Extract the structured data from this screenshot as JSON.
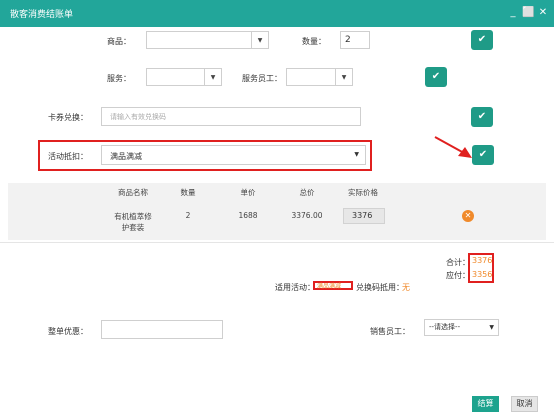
{
  "window": {
    "title": "散客消费结账单",
    "min": "_",
    "restore": "⬜",
    "close": "✕"
  },
  "form": {
    "product_label": "商品：",
    "product_value": "",
    "qty_label": "数量：",
    "qty_value": "2",
    "service_label": "服务：",
    "service_value": "",
    "staff_label": "服务员工：",
    "staff_value": "",
    "card_label": "卡券兑换：",
    "card_placeholder": "请输入有效兑换码",
    "promo_label": "活动抵扣：",
    "promo_value": "满品满减"
  },
  "table": {
    "headers": [
      "商品名称",
      "数量",
      "单价",
      "总价",
      "实际价格"
    ],
    "rows": [
      {
        "name": "有机植萃修护套装",
        "name_line1": "有机植萃修",
        "name_line2": "护套装",
        "qty": "2",
        "price": "1688",
        "total": "3376.00",
        "actual": "3376"
      }
    ]
  },
  "summary": {
    "total_label": "合计：",
    "total_value": "3376",
    "due_label": "应付：",
    "due_value": "3356",
    "activity_label": "适用活动：",
    "activity_value": "满品满减",
    "code_label": "兑换码抵用：",
    "code_value": "无"
  },
  "footer": {
    "discount_label": "整单优惠：",
    "discount_value": "",
    "sales_label": "销售员工：",
    "sales_value": "--请选择--",
    "settle": "结算",
    "cancel": "取消"
  },
  "colors": {
    "accent": "#22a69a",
    "button": "#1f9b87",
    "highlight": "#e0201f",
    "orange": "#f08a2b"
  }
}
